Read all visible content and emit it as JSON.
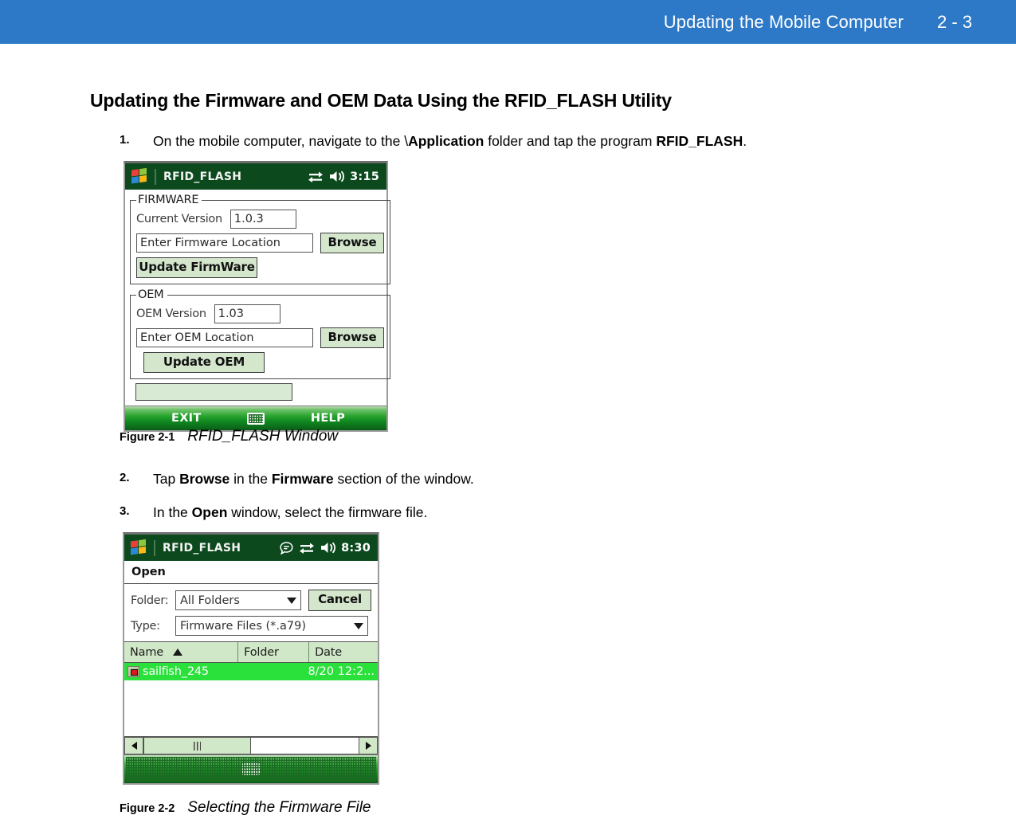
{
  "header": {
    "title": "Updating the Mobile Computer",
    "page_number": "2 - 3",
    "background_color": "#2d79c7"
  },
  "section": {
    "heading": "Updating the Firmware and OEM Data Using the RFID_FLASH Utility"
  },
  "steps": [
    {
      "number": "1.",
      "text_before": "On the mobile computer, navigate to the \\",
      "bold1": "Application",
      "text_mid": " folder and tap the program ",
      "bold2": "RFID_FLASH",
      "text_after": "."
    },
    {
      "number": "2.",
      "text_before": "Tap ",
      "bold1": "Browse",
      "text_mid": " in the ",
      "bold2": "Firmware",
      "text_after": " section of the window."
    },
    {
      "number": "3.",
      "text_before": "In the ",
      "bold1": "Open",
      "text_mid": " window, select the firmware file.",
      "bold2": "",
      "text_after": ""
    }
  ],
  "figures": [
    {
      "label": "Figure 2-1",
      "caption": "RFID_FLASH Window"
    },
    {
      "label": "Figure 2-2",
      "caption": "Selecting the Firmware File"
    }
  ],
  "device1": {
    "titlebar": {
      "app_name": "RFID_FLASH",
      "time": "3:15",
      "icons": [
        "windows-flag-icon",
        "connectivity-icon",
        "volume-icon"
      ]
    },
    "firmware_group": {
      "legend": "FIRMWARE",
      "version_label": "Current Version",
      "version_value": "1.0.3",
      "location_placeholder": "Enter Firmware Location",
      "browse_label": "Browse",
      "update_label": "Update FirmWare"
    },
    "oem_group": {
      "legend": "OEM",
      "version_label": "OEM Version",
      "version_value": "1.03",
      "location_placeholder": "Enter OEM Location",
      "browse_label": "Browse",
      "update_label": "Update OEM"
    },
    "status_value": "",
    "softkeys": {
      "left": "EXIT",
      "center_icon": "keyboard-icon",
      "right": "HELP"
    },
    "colors": {
      "titlebar": "#0c4a1e",
      "button_face": "#d4e7cd",
      "softbar_green": "#2aa530"
    }
  },
  "device2": {
    "titlebar": {
      "app_name": "RFID_FLASH",
      "time": "8:30",
      "icons": [
        "windows-flag-icon",
        "speech-bubble-icon",
        "connectivity-icon",
        "volume-icon"
      ]
    },
    "dialog_title": "Open",
    "folder_label": "Folder:",
    "folder_value": "All Folders",
    "cancel_label": "Cancel",
    "type_label": "Type:",
    "type_value": "Firmware Files (*.a79)",
    "columns": [
      "Name",
      "Folder",
      "Date"
    ],
    "sort_column": "Name",
    "sort_direction": "ascending",
    "rows": [
      {
        "name": "sailfish_245",
        "folder": "",
        "date": "8/20 12:2...",
        "selected": true
      }
    ],
    "softkeys": {
      "center_icon": "keyboard-icon"
    },
    "colors": {
      "titlebar": "#0c4a1e",
      "header_face": "#d0e8c8",
      "selection": "#2ae03a"
    }
  }
}
